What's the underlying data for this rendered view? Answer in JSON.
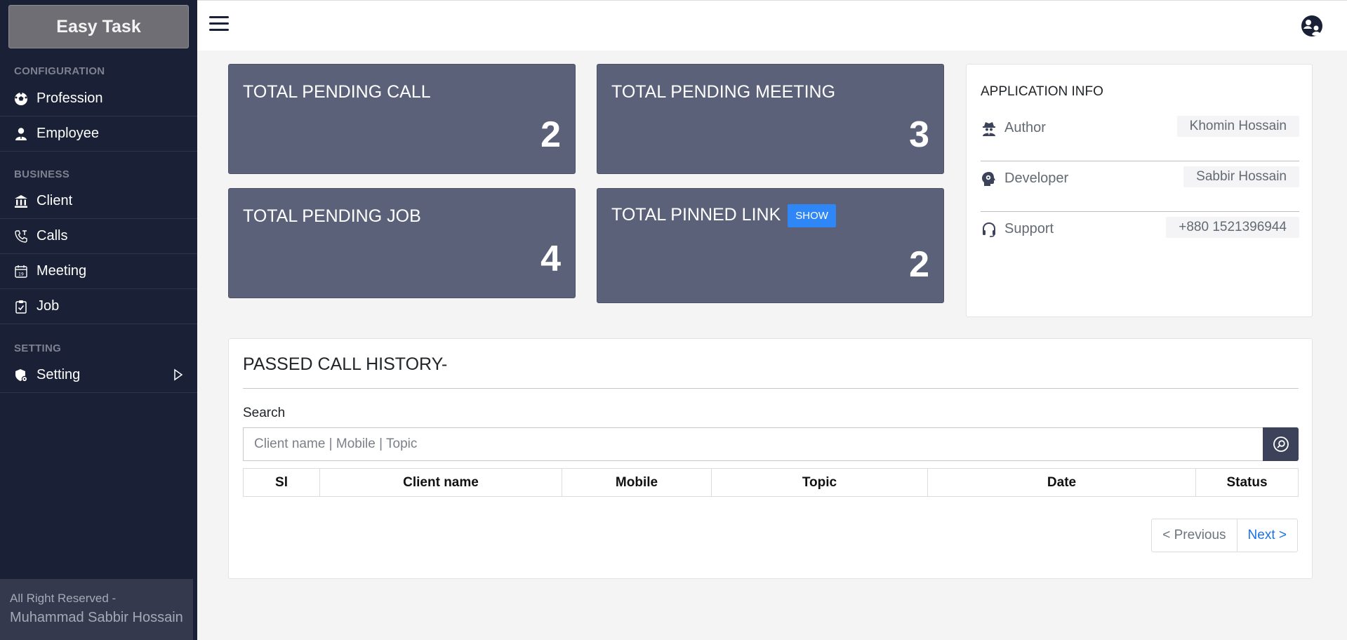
{
  "sidebar": {
    "brand": "Easy Task",
    "sections": {
      "configuration": "CONFIGURATION",
      "business": "BUSINESS",
      "setting": "SETTING"
    },
    "items": [
      {
        "label": "Profession",
        "icon": "soccer-ball-icon"
      },
      {
        "label": "Employee",
        "icon": "person-icon"
      },
      {
        "label": "Client",
        "icon": "bank-icon"
      },
      {
        "label": "Calls",
        "icon": "phone-icon"
      },
      {
        "label": "Meeting",
        "icon": "calendar-icon"
      },
      {
        "label": "Job",
        "icon": "clipboard-check-icon"
      },
      {
        "label": "Setting",
        "icon": "gear-shield-icon"
      }
    ],
    "footer": {
      "line1": "All Right Reserved -",
      "line2": "Muhammad Sabbir Hossain"
    }
  },
  "stats": {
    "pending_call": {
      "title": "TOTAL PENDING CALL",
      "value": "2"
    },
    "pending_meeting": {
      "title": "TOTAL PENDING MEETING",
      "value": "3"
    },
    "pending_job": {
      "title": "TOTAL PENDING JOB",
      "value": "4"
    },
    "pinned_link": {
      "title": "TOTAL PINNED LINK",
      "value": "2",
      "button": "SHOW"
    }
  },
  "app_info": {
    "title": "APPLICATION INFO",
    "rows": [
      {
        "label": "Author",
        "value": "Khomin Hossain",
        "icon": "spy-icon"
      },
      {
        "label": "Developer",
        "value": "Sabbir Hossain",
        "icon": "head-gear-icon"
      },
      {
        "label": "Support",
        "value": "+880 1521396944",
        "icon": "headset-icon"
      }
    ]
  },
  "history": {
    "title": "PASSED CALL HISTORY-",
    "search_label": "Search",
    "search_placeholder": "Client name | Mobile | Topic",
    "columns": [
      "Sl",
      "Client name",
      "Mobile",
      "Topic",
      "Date",
      "Status"
    ],
    "prev_label": "< Previous",
    "next_label": "Next >"
  },
  "colors": {
    "sidebar_bg": "#1a2035",
    "card_bg": "#5b6179",
    "show_button": "#2f86f6",
    "link_blue": "#1a73e8"
  }
}
